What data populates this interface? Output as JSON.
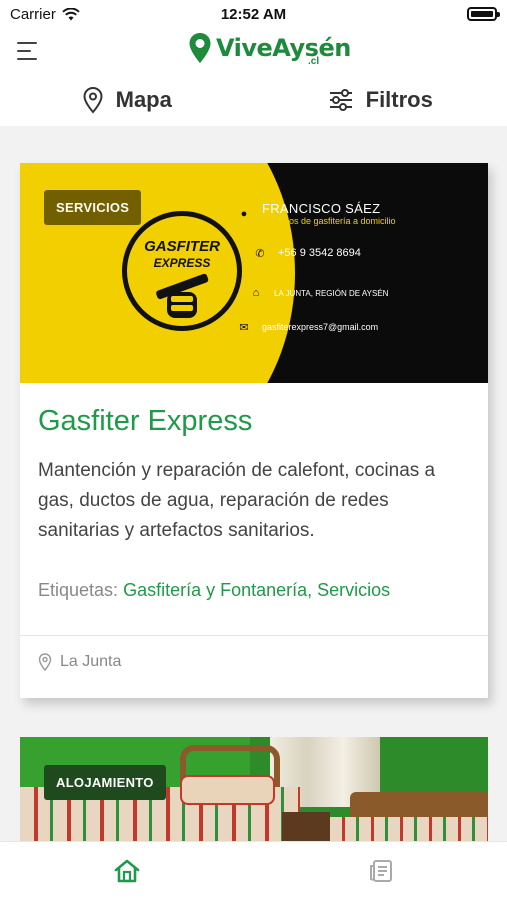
{
  "status": {
    "carrier": "Carrier",
    "time": "12:52 AM"
  },
  "header": {
    "logo_text": "ViveAysén",
    "logo_suffix": ".cl"
  },
  "toolbar": {
    "map_label": "Mapa",
    "filters_label": "Filtros"
  },
  "listings": [
    {
      "category": "SERVICIOS",
      "image": {
        "emblem_title": "GASFITER",
        "emblem_sub": "EXPRESS",
        "owner": "FRANCISCO SÁEZ",
        "tagline": "Servicios de gasfitería a domicilio",
        "phone": "+56 9 3542 8694",
        "address": "LA JUNTA, REGIÓN DE AYSÉN",
        "email": "gasfiterexpress7@gmail.com"
      },
      "title": "Gasfiter Express",
      "description": "Mantención y reparación de calefont, cocinas a gas, ductos de agua, reparación de redes sanitarias y artefactos sanitarios.",
      "tags_label": "Etiquetas:",
      "tags": "Gasfitería y Fontanería, Servicios",
      "location": "La Junta"
    },
    {
      "category": "ALOJAMIENTO"
    }
  ],
  "colors": {
    "brand_green": "#1e9a4a",
    "logo_yellow": "#f2cf00",
    "card_black": "#0b0b0b"
  },
  "tabs": [
    {
      "icon": "home-icon",
      "active": true
    },
    {
      "icon": "news-icon",
      "active": false
    }
  ]
}
